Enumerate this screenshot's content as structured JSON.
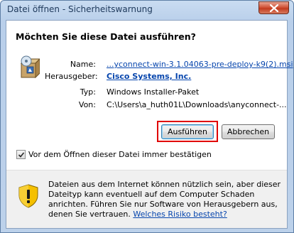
{
  "window": {
    "title": "Datei öffnen - Sicherheitswarnung",
    "heading": "Möchten Sie diese Datei ausführen?"
  },
  "details": [
    {
      "label": "Name:",
      "value": "...yconnect-win-3.1.04063-pre-deploy-k9(2).msi",
      "link": true
    },
    {
      "label": "Herausgeber:",
      "value": "Cisco Systems, Inc.",
      "link": true
    },
    {
      "label": "Typ:",
      "value": "Windows Installer-Paket",
      "link": false
    },
    {
      "label": "Von:",
      "value": "C:\\Users\\a_huth01L\\Downloads\\anyconnect-...",
      "link": false
    }
  ],
  "buttons": {
    "run": "Ausführen",
    "cancel": "Abbrechen"
  },
  "checkbox": {
    "label": "Vor dem Öffnen dieser Datei immer bestätigen",
    "checked": true
  },
  "warning": {
    "text": "Dateien aus dem Internet können nützlich sein, aber dieser Dateityp kann eventuell auf dem Computer Schaden anrichten. Führen Sie nur Software von Herausgebern aus, denen Sie vertrauen.",
    "link": "Welches Risiko besteht?"
  },
  "colors": {
    "highlight": "#e00000",
    "link": "#0645ad",
    "close": "#c23b1f"
  },
  "icons": [
    "close-icon",
    "installer-package-icon",
    "checkmark-icon",
    "shield-warning-icon"
  ]
}
